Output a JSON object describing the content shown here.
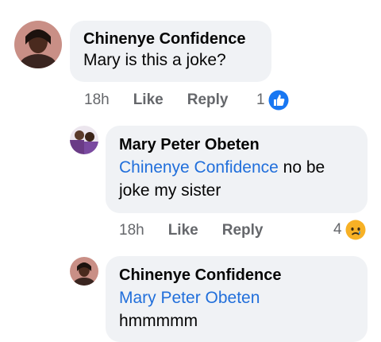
{
  "comments": [
    {
      "author": "Chinenye Confidence",
      "text": "Mary is this a joke?",
      "time": "18h",
      "like_label": "Like",
      "reply_label": "Reply",
      "reaction_count": "1",
      "reaction_icon": "like-reaction-icon"
    },
    {
      "author": "Mary Peter Obeten",
      "mention": "Chinenye Confidence",
      "text_inline": " no be",
      "text_line2": "joke my sister",
      "time": "18h",
      "like_label": "Like",
      "reply_label": "Reply",
      "reaction_count": "4",
      "reaction_icon": "sad-reaction-icon"
    },
    {
      "author": "Chinenye Confidence",
      "mention": "Mary Peter Obeten",
      "text": "hmmmmm"
    }
  ],
  "colors": {
    "bubble": "#f0f2f5",
    "mention": "#216fdb",
    "meta": "#65676b",
    "like_blue": "#1877f2",
    "sad_yellow": "#f7b125"
  }
}
